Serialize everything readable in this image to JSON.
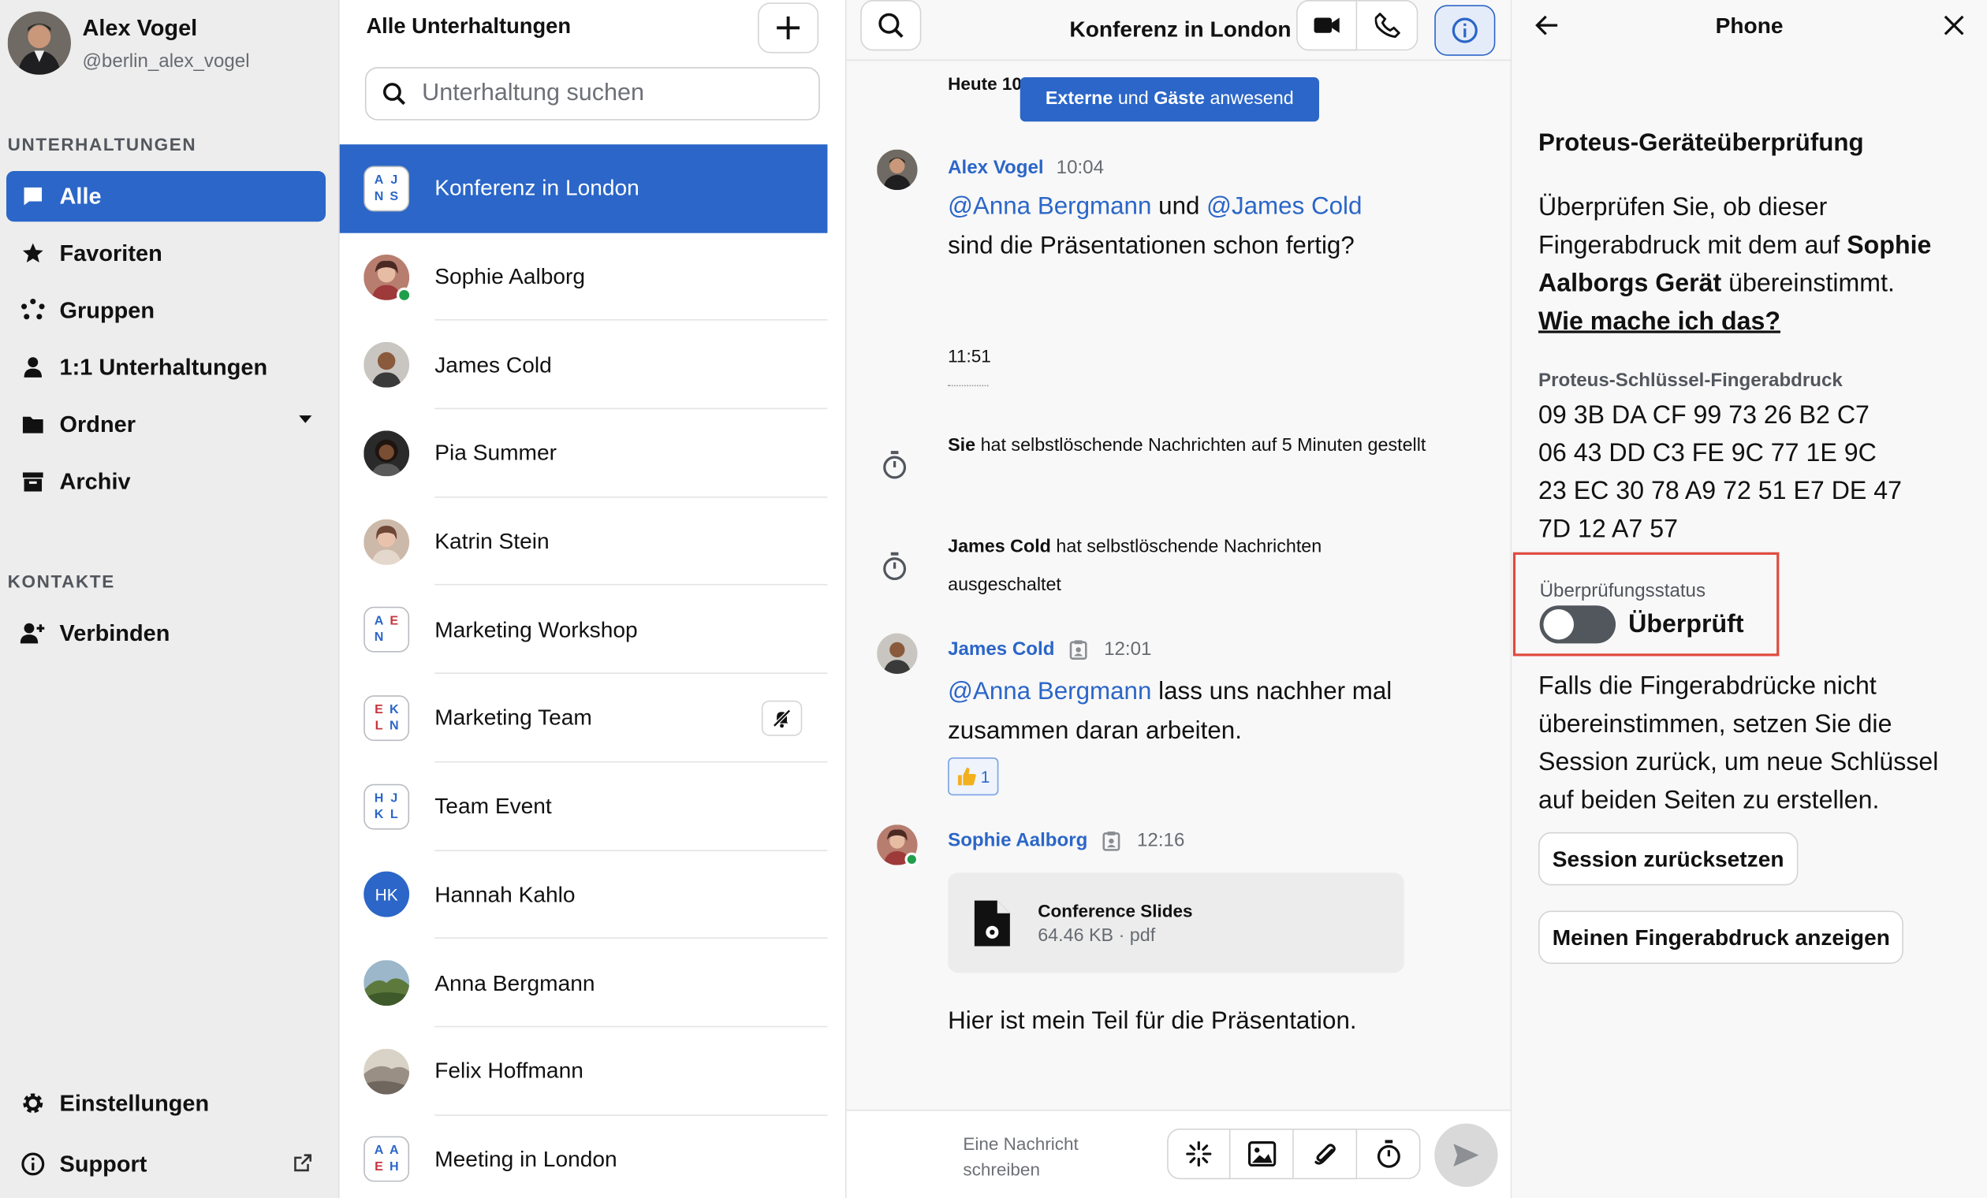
{
  "user": {
    "name": "Alex Vogel",
    "handle": "@berlin_alex_vogel"
  },
  "sidebar": {
    "section_conversations": "UNTERHALTUNGEN",
    "items": [
      {
        "label": "Alle",
        "icon": "chat-bubble-icon"
      },
      {
        "label": "Favoriten",
        "icon": "star-icon"
      },
      {
        "label": "Gruppen",
        "icon": "group-icon"
      },
      {
        "label": "1:1 Unterhaltungen",
        "icon": "person-icon"
      },
      {
        "label": "Ordner",
        "icon": "folder-icon"
      },
      {
        "label": "Archiv",
        "icon": "archive-icon"
      }
    ],
    "section_contacts": "KONTAKTE",
    "contacts_item": "Verbinden",
    "settings": "Einstellungen",
    "support": "Support"
  },
  "conversation_list": {
    "title": "Alle Unterhaltungen",
    "search_placeholder": "Unterhaltung suchen",
    "items": [
      {
        "name": "Konferenz in London",
        "group_initials": [
          "A",
          "J",
          "N",
          "S"
        ]
      },
      {
        "name": "Sophie Aalborg"
      },
      {
        "name": "James Cold"
      },
      {
        "name": "Pia Summer"
      },
      {
        "name": "Katrin Stein"
      },
      {
        "name": "Marketing Workshop",
        "group_initials": [
          "A",
          "E",
          "N",
          ""
        ]
      },
      {
        "name": "Marketing Team",
        "group_initials": [
          "E",
          "K",
          "L",
          "N"
        ]
      },
      {
        "name": "Team Event",
        "group_initials": [
          "H",
          "J",
          "K",
          "L"
        ]
      },
      {
        "name": "Hannah Kahlo",
        "initials": "HK"
      },
      {
        "name": "Anna Bergmann"
      },
      {
        "name": "Felix Hoffmann"
      },
      {
        "name": "Meeting in London",
        "group_initials": [
          "A",
          "A",
          "E",
          "H"
        ]
      }
    ]
  },
  "chat": {
    "title": "Konferenz in London",
    "day_separator": "Heute 10:04",
    "guests_banner": {
      "part1": "Externe",
      "mid": " und ",
      "part2": "Gäste",
      "end": " anwesend"
    },
    "messages": {
      "m1": {
        "author": "Alex Vogel",
        "time": "10:04",
        "mention1": "@Anna Bergmann",
        "mid": " und ",
        "mention2": "@James Cold",
        "text": "sind die Präsentationen schon fertig?"
      },
      "time_sep": "11:51",
      "sys1": {
        "actor": "Sie",
        "text": " hat selbstlöschende Nachrichten auf 5 Minuten gestellt"
      },
      "sys2": {
        "actor": "James Cold",
        "text": " hat selbstlöschende Nachrichten ausgeschaltet"
      },
      "m2": {
        "author": "James Cold",
        "time": "12:01",
        "mention": "@Anna Bergmann",
        "text": " lass uns nachher mal zusammen daran arbeiten.",
        "reaction_count": "1"
      },
      "m3": {
        "author": "Sophie Aalborg",
        "time": "12:16",
        "file_name": "Conference Slides",
        "file_meta": "64.46 KB · pdf",
        "text": "Hier ist mein Teil für die Präsentation."
      }
    },
    "composer_placeholder": "Eine Nachricht schreiben"
  },
  "panel": {
    "title": "Phone",
    "heading": "Proteus-Geräteüberprüfung",
    "desc_pre": "Überprüfen Sie, ob dieser Fingerabdruck mit dem auf ",
    "desc_bold": "Sophie Aalborgs Gerät",
    "desc_post": " übereinstimmt.",
    "help_link": "Wie mache ich das?",
    "fingerprint_label": "Proteus-Schlüssel-Fingerabdruck",
    "fingerprint_lines": [
      "09 3B DA CF 99 73 26 B2 C7",
      "06 43 DD C3 FE 9C 77 1E 9C",
      "23 EC 30 78 A9 72 51 E7 DE 47",
      "7D 12 A7 57"
    ],
    "status_label": "Überprüfungsstatus",
    "status_value": "Überprüft",
    "verified": false,
    "warning": "Falls die Fingerabdrücke nicht übereinstimmen, setzen Sie die Session zurück, um neue Schlüssel auf beiden Seiten zu erstellen.",
    "reset_button": "Session zurücksetzen",
    "show_fingerprint_button": "Meinen Fingerabdruck anzeigen"
  },
  "colors": {
    "accent": "#2b66c8",
    "highlight_border": "#e04a3f",
    "presence": "#1f9e4b",
    "group_letter_blue": "#2b66c8",
    "group_letter_red": "#c8343d"
  }
}
